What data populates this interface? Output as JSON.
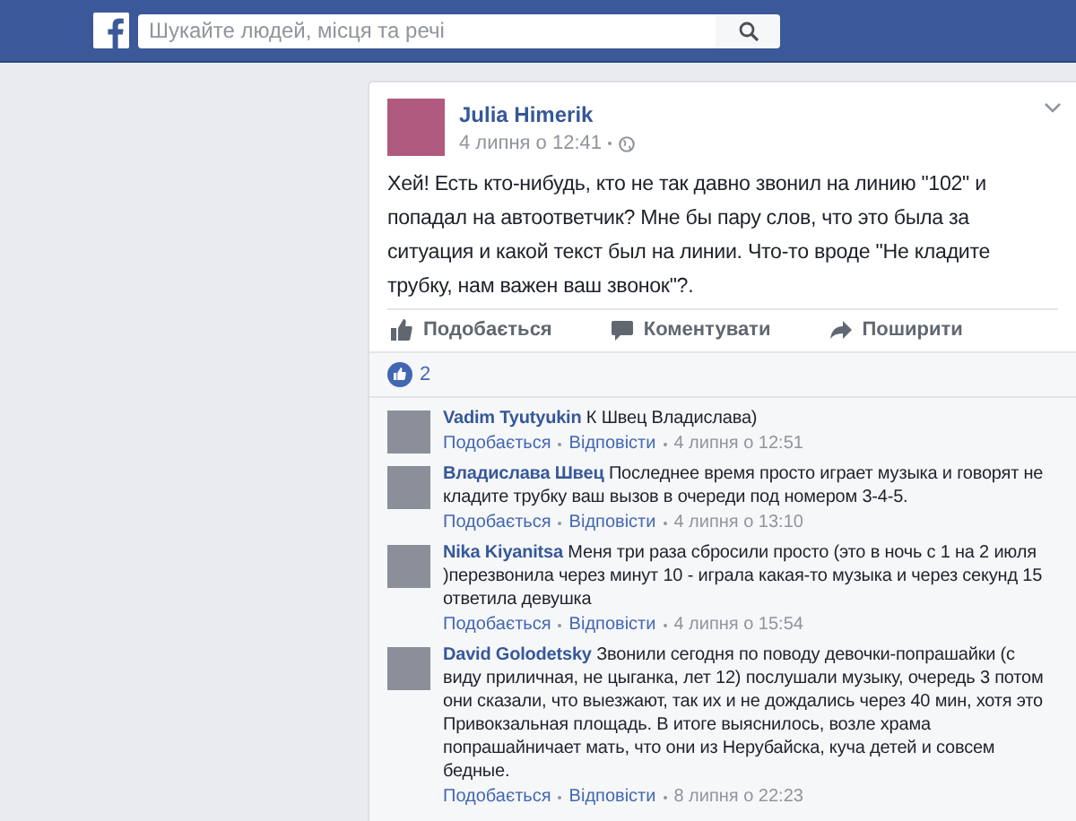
{
  "top_bar": {
    "search": {
      "placeholder": "Шукайте людей, місця та речі"
    }
  },
  "post": {
    "author": "Julia Himerik",
    "time": "4 липня о 12:41",
    "text": "Хей! Есть кто-нибудь, кто не так давно звонил на линию \"102\" и попадал на автоответчик? Мне бы пару слов, что это была за ситуация и какой текст был на линии. Что-то вроде \"Не кладите трубку, нам важен ваш звонок\"?.",
    "actions": [
      {
        "kind": "like",
        "label": "Подобається"
      },
      {
        "kind": "comment",
        "label": "Коментувати"
      },
      {
        "kind": "share",
        "label": "Поширити"
      }
    ],
    "like_count": "2",
    "comments": [
      {
        "author": "Vadim Tyutyukin",
        "text": "К Швец Владислава)",
        "like": "Подобається",
        "reply": "Відповісти",
        "time": "4 липня о 12:51"
      },
      {
        "author": "Владислава Швец",
        "text": "Последнее время просто играет музыка и говорят не кладите трубку ваш вызов в очереди под номером 3-4-5.",
        "like": "Подобається",
        "reply": "Відповісти",
        "time": "4 липня о 13:10"
      },
      {
        "author": "Nika Kiyanitsa",
        "text": "Меня три раза сбросили просто (это в ночь с 1 на 2 июля )перезвонила через минут 10 - играла какая-то музыка и через секунд 15 ответила девушка",
        "like": "Подобається",
        "reply": "Відповісти",
        "time": "4 липня о 15:54"
      },
      {
        "author": "David Golodetsky",
        "text": "Звонили сегодня по поводу девочки-попрашайки (с виду приличная, не цыганка, лет 12) послушали музыку, очередь 3 потом они сказали, что выезжают, так их и не дождались через 40 мин, хотя это Привокзальная площадь. В итоге выяснилось, возле храма попрашайничает мать, что они из Нерубайска, куча детей и совсем бедные.",
        "like": "Подобається",
        "reply": "Відповісти",
        "time": "8 липня о 22:23"
      }
    ]
  }
}
